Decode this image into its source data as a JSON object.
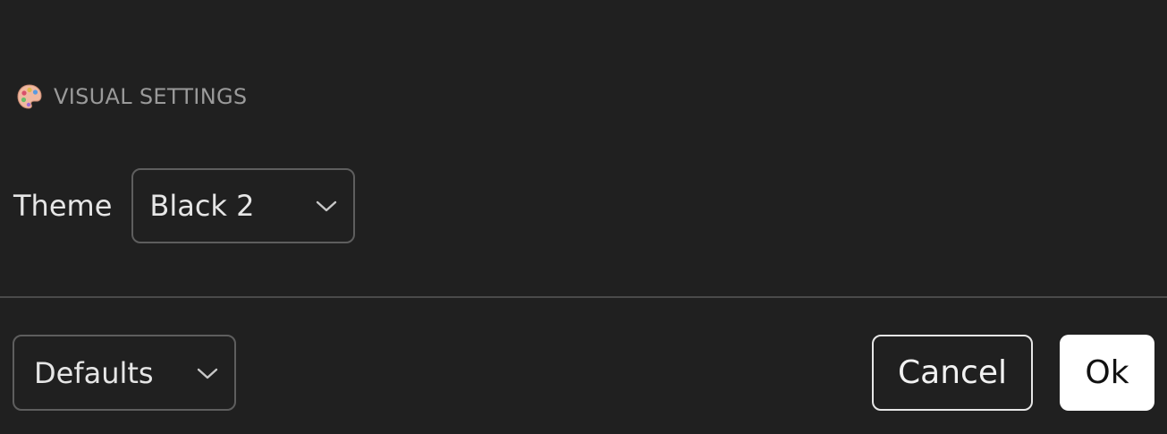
{
  "visual_settings": {
    "icon": "artist-palette-icon",
    "title": "VISUAL SETTINGS"
  },
  "theme": {
    "label": "Theme",
    "selected": "Black 2"
  },
  "footer": {
    "defaults_selected": "Defaults",
    "cancel_label": "Cancel",
    "ok_label": "Ok"
  },
  "colors": {
    "background": "#202020",
    "text": "#e6e6e6",
    "muted_text": "#9a9a9a",
    "border": "#5e5e5e",
    "primary_button_bg": "#ffffff",
    "primary_button_text": "#111111"
  }
}
